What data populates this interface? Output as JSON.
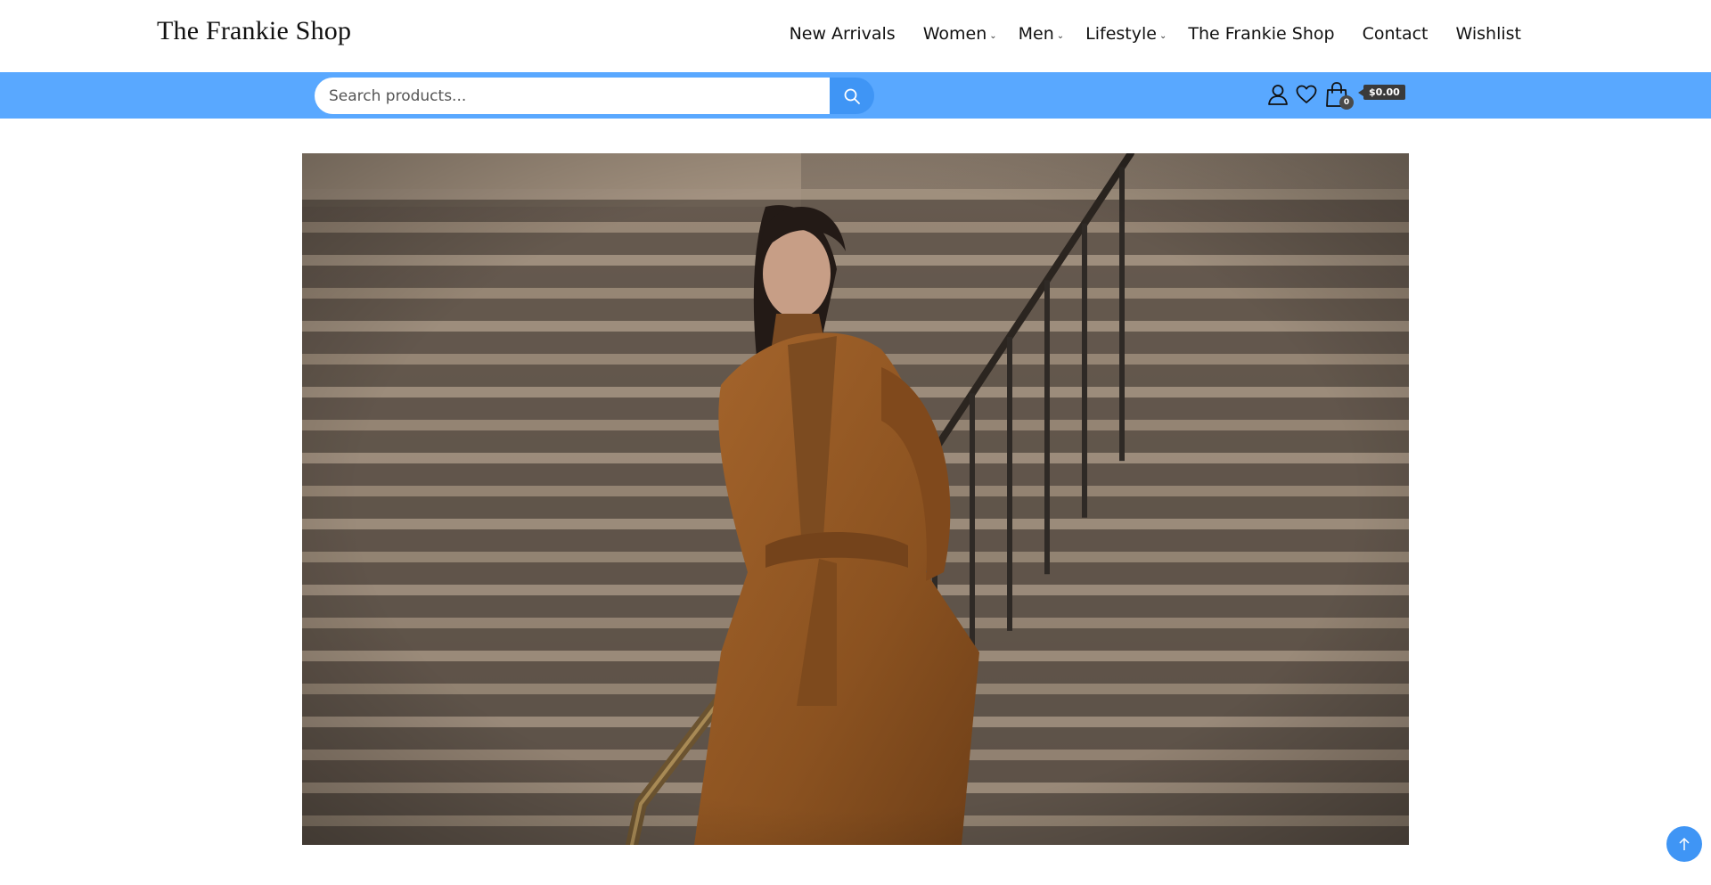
{
  "header": {
    "logo": "The Frankie Shop",
    "nav": [
      {
        "label": "New Arrivals",
        "dropdown": false
      },
      {
        "label": "Women",
        "dropdown": true
      },
      {
        "label": "Men",
        "dropdown": true
      },
      {
        "label": "Lifestyle",
        "dropdown": true
      },
      {
        "label": "The Frankie Shop",
        "dropdown": false
      },
      {
        "label": "Contact",
        "dropdown": false
      },
      {
        "label": "Wishlist",
        "dropdown": false
      }
    ]
  },
  "search": {
    "placeholder": "Search products...",
    "value": "",
    "button_icon": "search-icon"
  },
  "account": {
    "icons": [
      "user-icon",
      "heart-icon",
      "shopping-bag-icon"
    ],
    "cart_count": "0",
    "cart_total": "$0.00"
  },
  "hero": {
    "image_icon": "hero-photo"
  },
  "scroll_top_icon": "arrow-up-icon",
  "colors": {
    "bar": "#59a8ff",
    "accent": "#3f95f5",
    "badge": "#3a3a3a"
  }
}
